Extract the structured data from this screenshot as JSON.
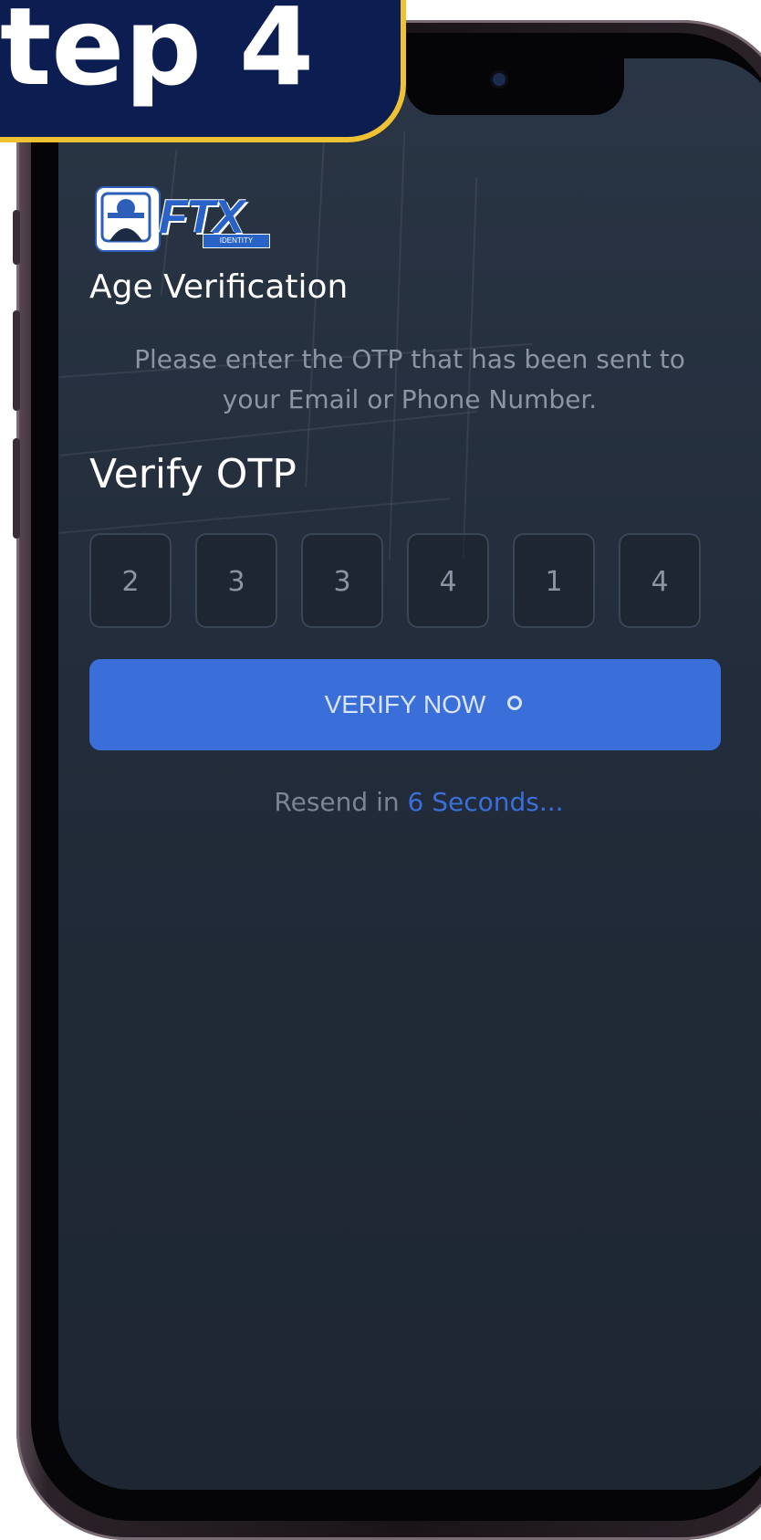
{
  "banner": {
    "label": "tep 4"
  },
  "logo": {
    "text": "FTX",
    "subtext": "IDENTITY"
  },
  "screen": {
    "age_title": "Age Verification",
    "instruction_line1": "Please enter the OTP that has been sent to",
    "instruction_line2": "your Email or Phone Number.",
    "verify_title": "Verify OTP",
    "otp_digits": [
      "2",
      "3",
      "3",
      "4",
      "1",
      "4"
    ],
    "verify_button": "VERIFY NOW",
    "resend_prefix": "Resend in ",
    "resend_countdown": "6 Seconds..."
  },
  "colors": {
    "accent": "#3a6fda",
    "banner_bg": "#0c1d52",
    "banner_border": "#f0c233",
    "screen_bg": "#222c3a"
  },
  "icons": {
    "loading": "spinner-icon",
    "logo_badge": "face-scan-icon"
  }
}
